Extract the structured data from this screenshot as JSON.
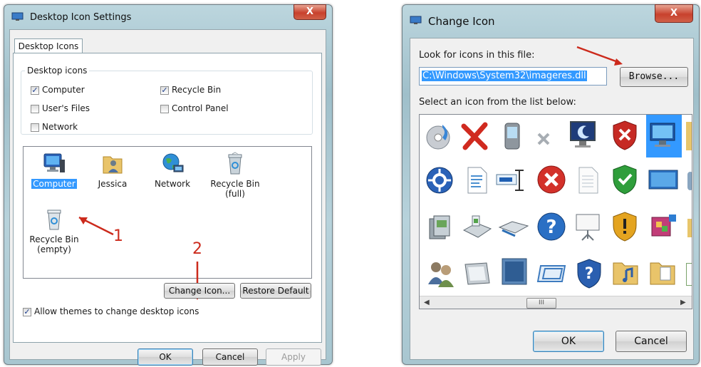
{
  "left_dialog": {
    "title": "Desktop Icon Settings",
    "close_label": "X",
    "tab": "Desktop Icons",
    "group_label": "Desktop icons",
    "checkboxes": [
      {
        "label": "Computer",
        "checked": true
      },
      {
        "label": "Recycle Bin",
        "checked": true
      },
      {
        "label": "User's Files",
        "checked": false
      },
      {
        "label": "Control Panel",
        "checked": false
      },
      {
        "label": "Network",
        "checked": false
      }
    ],
    "icons": [
      {
        "label": "Computer",
        "icon": "computer-icon",
        "selected": true
      },
      {
        "label": "Jessica",
        "icon": "user-folder-icon",
        "selected": false
      },
      {
        "label": "Network",
        "icon": "network-globe-icon",
        "selected": false
      },
      {
        "label": "Recycle Bin",
        "label2": "(full)",
        "icon": "recycle-bin-full-icon",
        "selected": false
      },
      {
        "label": "Recycle Bin",
        "label2": "(empty)",
        "icon": "recycle-bin-empty-icon",
        "selected": false
      }
    ],
    "change_icon": "Change Icon...",
    "restore_default": "Restore Default",
    "allow_themes": {
      "label": "Allow themes to change desktop icons",
      "checked": true
    },
    "ok": "OK",
    "cancel": "Cancel",
    "apply": "Apply",
    "annotations": [
      "1",
      "2"
    ]
  },
  "right_dialog": {
    "title": "Change Icon",
    "close_label": "X",
    "look_label": "Look for icons in this file:",
    "path_value": "C:\\Windows\\System32\\imageres.dll",
    "browse": "Browse...",
    "list_label": "Select an icon from the list below:",
    "scroll_thumb": "III",
    "ok": "OK",
    "cancel": "Cancel"
  },
  "colors": {
    "accent": "#3399ff",
    "annotation": "#cc2a1c",
    "title_close": "#c8412d"
  }
}
